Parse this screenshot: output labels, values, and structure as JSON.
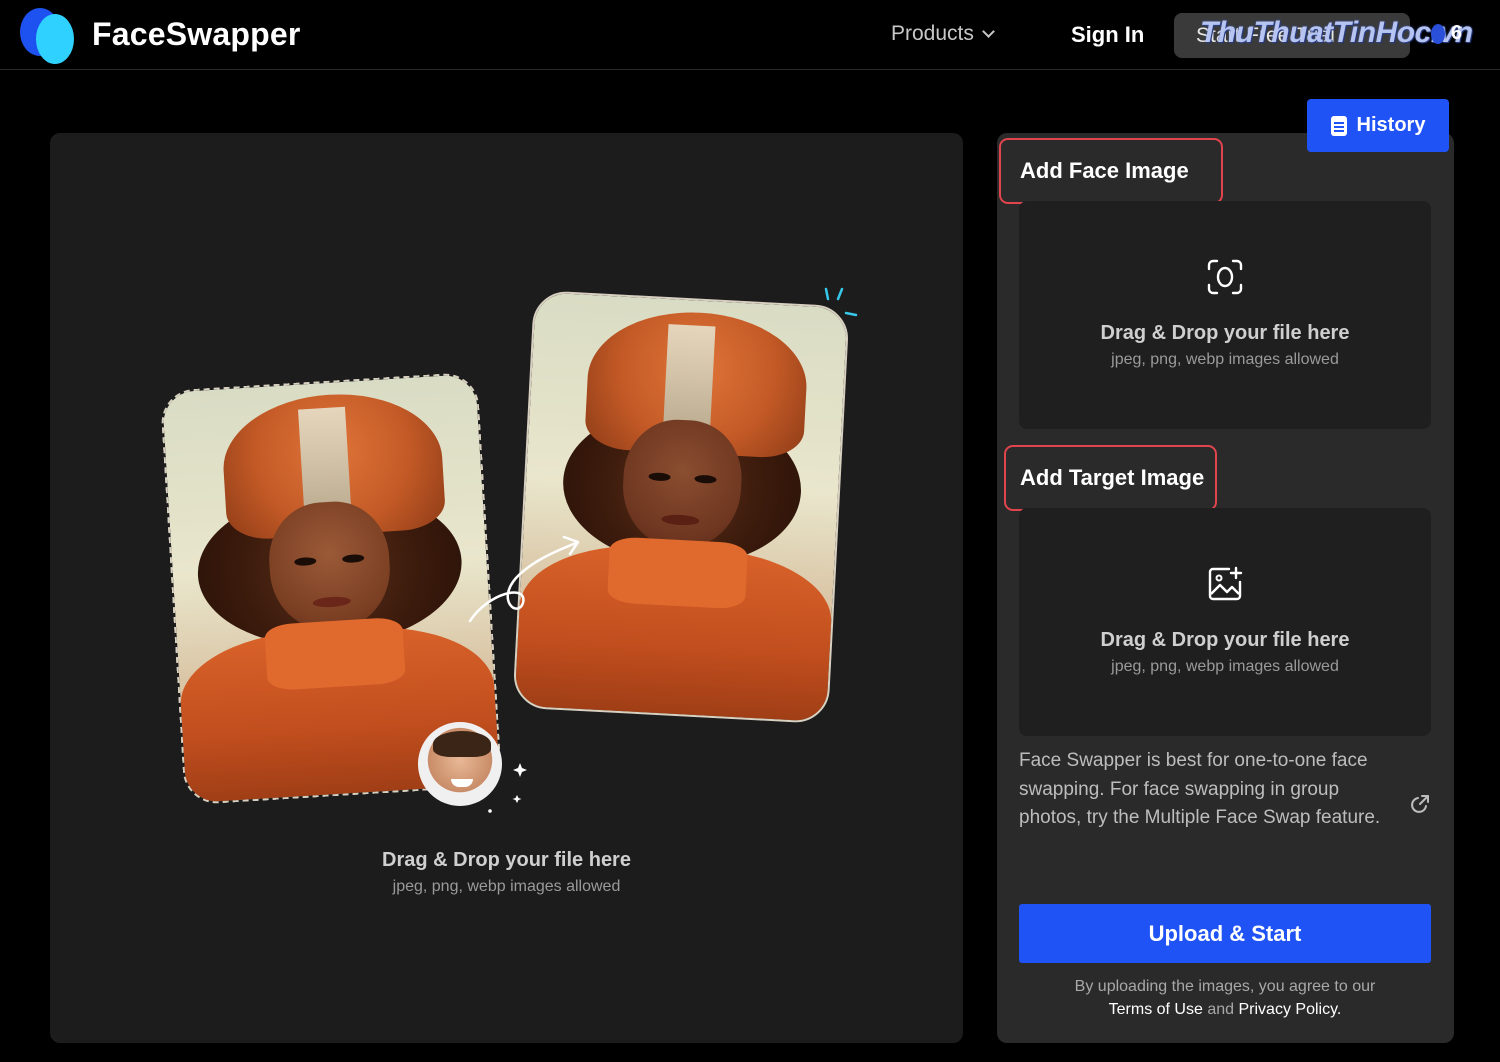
{
  "header": {
    "brand": "FaceSwapper",
    "products_label": "Products",
    "sign_in_label": "Sign In",
    "start_label": "Start Free Trial",
    "watermark": "ThuThuatTinHoc.vn",
    "credit_count": "6"
  },
  "left_panel": {
    "drop_title": "Drag & Drop your file here",
    "drop_sub": "jpeg, png, webp images allowed"
  },
  "right_panel": {
    "history_label": "History",
    "face_section": {
      "label": "Add Face Image",
      "drop_title": "Drag & Drop your file here",
      "drop_sub": "jpeg, png, webp images allowed"
    },
    "target_section": {
      "label": "Add Target Image",
      "drop_title": "Drag & Drop your file here",
      "drop_sub": "jpeg, png, webp images allowed"
    },
    "info_text": "Face Swapper is best for one-to-one face swapping. For face swapping in group photos, try the Multiple Face Swap feature.",
    "upload_label": "Upload & Start",
    "terms": {
      "prefix": "By uploading the images, you agree to our",
      "terms_link": "Terms of Use",
      "and": "and",
      "privacy_link": "Privacy Policy."
    }
  },
  "colors": {
    "accent": "#1f53f5",
    "highlight": "#e0454d",
    "panel": "#2a2a2a"
  }
}
